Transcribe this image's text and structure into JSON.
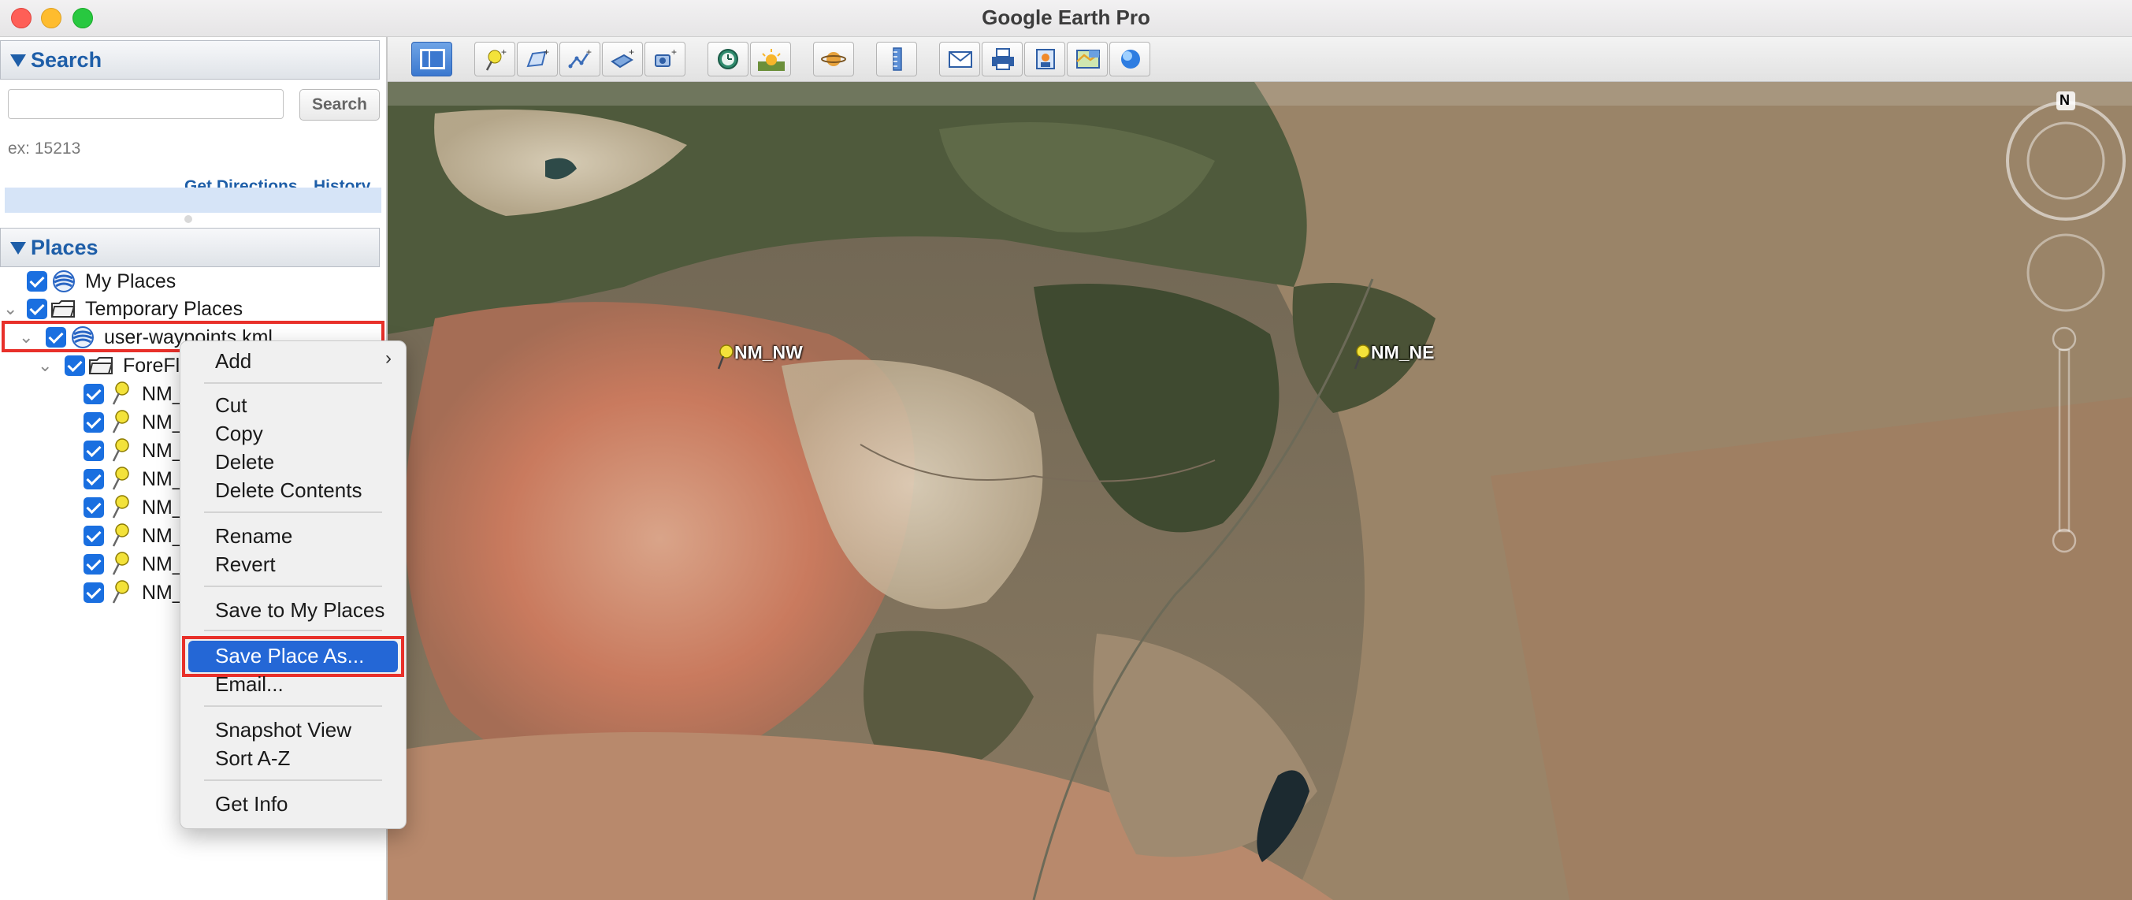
{
  "window": {
    "title": "Google Earth Pro"
  },
  "search_panel": {
    "header": "Search",
    "input_value": "",
    "search_button": "Search",
    "hint": "ex: 15213",
    "get_directions": "Get Directions",
    "history": "History"
  },
  "places_panel": {
    "header": "Places",
    "items": [
      {
        "label": "My Places",
        "checked": true,
        "icon": "globe-icon"
      },
      {
        "label": "Temporary Places",
        "checked": true,
        "icon": "folder-icon"
      },
      {
        "label": "user-waypoints.kml",
        "checked": true,
        "icon": "globe-icon",
        "selected": true
      },
      {
        "label": "ForeFl",
        "checked": true,
        "icon": "folder-icon"
      },
      {
        "label": "NM_",
        "checked": true,
        "icon": "pushpin-icon"
      },
      {
        "label": "NM_",
        "checked": true,
        "icon": "pushpin-icon"
      },
      {
        "label": "NM_",
        "checked": true,
        "icon": "pushpin-icon"
      },
      {
        "label": "NM_",
        "checked": true,
        "icon": "pushpin-icon"
      },
      {
        "label": "NM_",
        "checked": true,
        "icon": "pushpin-icon"
      },
      {
        "label": "NM_",
        "checked": true,
        "icon": "pushpin-icon"
      },
      {
        "label": "NM_",
        "checked": true,
        "icon": "pushpin-icon"
      },
      {
        "label": "NM_",
        "checked": true,
        "icon": "pushpin-icon"
      }
    ]
  },
  "context_menu": {
    "items": [
      {
        "label": "Add",
        "submenu": true
      },
      {
        "label": "Cut"
      },
      {
        "label": "Copy"
      },
      {
        "label": "Delete"
      },
      {
        "label": "Delete Contents"
      },
      {
        "label": "Rename"
      },
      {
        "label": "Revert"
      },
      {
        "label": "Save to My Places"
      },
      {
        "label": "Save Place As...",
        "highlighted": true
      },
      {
        "label": "Email..."
      },
      {
        "label": "Snapshot View"
      },
      {
        "label": "Sort A-Z"
      },
      {
        "label": "Get Info"
      }
    ],
    "submenu_glyph": "›"
  },
  "toolbar": {
    "buttons": [
      "sidebar-toggle-icon",
      "add-placemark-icon",
      "add-polygon-icon",
      "add-path-icon",
      "add-image-overlay-icon",
      "record-tour-icon",
      "historical-imagery-icon",
      "sunlight-icon",
      "switch-planet-icon",
      "ruler-icon",
      "email-icon",
      "print-icon",
      "save-image-icon",
      "view-in-maps-icon",
      "earth-gallery-icon"
    ]
  },
  "map": {
    "placemarks": [
      {
        "label": "NM_NW"
      },
      {
        "label": "NM_NE"
      }
    ],
    "compass_north": "N"
  },
  "colors": {
    "accent_blue": "#1e5ea8",
    "checkbox_blue": "#1a6fe0",
    "highlight_red": "#e8302a",
    "menu_selection": "#2467d6"
  }
}
